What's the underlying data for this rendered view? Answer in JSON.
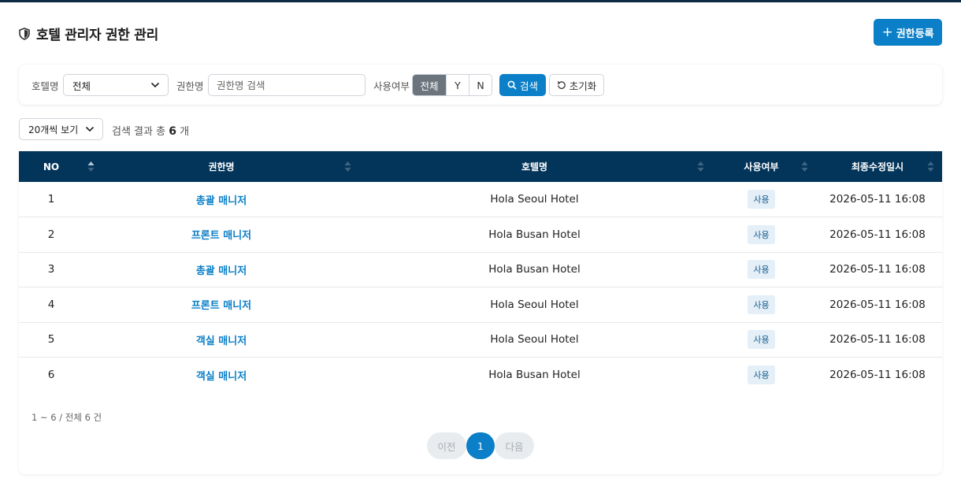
{
  "header": {
    "title": "호텔 관리자 권한 관리",
    "register_label": "권한등록"
  },
  "filters": {
    "hotel_label": "호텔명",
    "hotel_value": "전체",
    "role_label": "권한명",
    "role_placeholder": "권한명 검색",
    "use_label": "사용여부",
    "use_options": [
      "전체",
      "Y",
      "N"
    ],
    "use_selected": "전체",
    "search_label": "검색",
    "reset_label": "초기화"
  },
  "list_controls": {
    "page_size": "20개씩 보기",
    "result_prefix": "검색 결과 총",
    "result_count": "6",
    "result_suffix": "개"
  },
  "table": {
    "columns": [
      "NO",
      "권한명",
      "호텔명",
      "사용여부",
      "최종수정일시"
    ],
    "rows": [
      {
        "no": "1",
        "role": "총괄 매니저",
        "hotel": "Hola Seoul Hotel",
        "use": "사용",
        "updated": "2026-05-11 16:08"
      },
      {
        "no": "2",
        "role": "프론트 매니저",
        "hotel": "Hola Busan Hotel",
        "use": "사용",
        "updated": "2026-05-11 16:08"
      },
      {
        "no": "3",
        "role": "총괄 매니저",
        "hotel": "Hola Busan Hotel",
        "use": "사용",
        "updated": "2026-05-11 16:08"
      },
      {
        "no": "4",
        "role": "프론트 매니저",
        "hotel": "Hola Seoul Hotel",
        "use": "사용",
        "updated": "2026-05-11 16:08"
      },
      {
        "no": "5",
        "role": "객실 매니저",
        "hotel": "Hola Seoul Hotel",
        "use": "사용",
        "updated": "2026-05-11 16:08"
      },
      {
        "no": "6",
        "role": "객실 매니저",
        "hotel": "Hola Busan Hotel",
        "use": "사용",
        "updated": "2026-05-11 16:08"
      }
    ]
  },
  "pagination": {
    "range_text": "1 ~ 6 / 전체 6 건",
    "prev_label": "이전",
    "current_page": "1",
    "next_label": "다음"
  },
  "colors": {
    "primary": "#0b7fc7",
    "table_header": "#03355a",
    "top_bar": "#0f2a44"
  },
  "icons": [
    "shield-icon",
    "plus-icon",
    "chevron-down-icon",
    "search-icon",
    "reset-icon",
    "sort-icon"
  ]
}
